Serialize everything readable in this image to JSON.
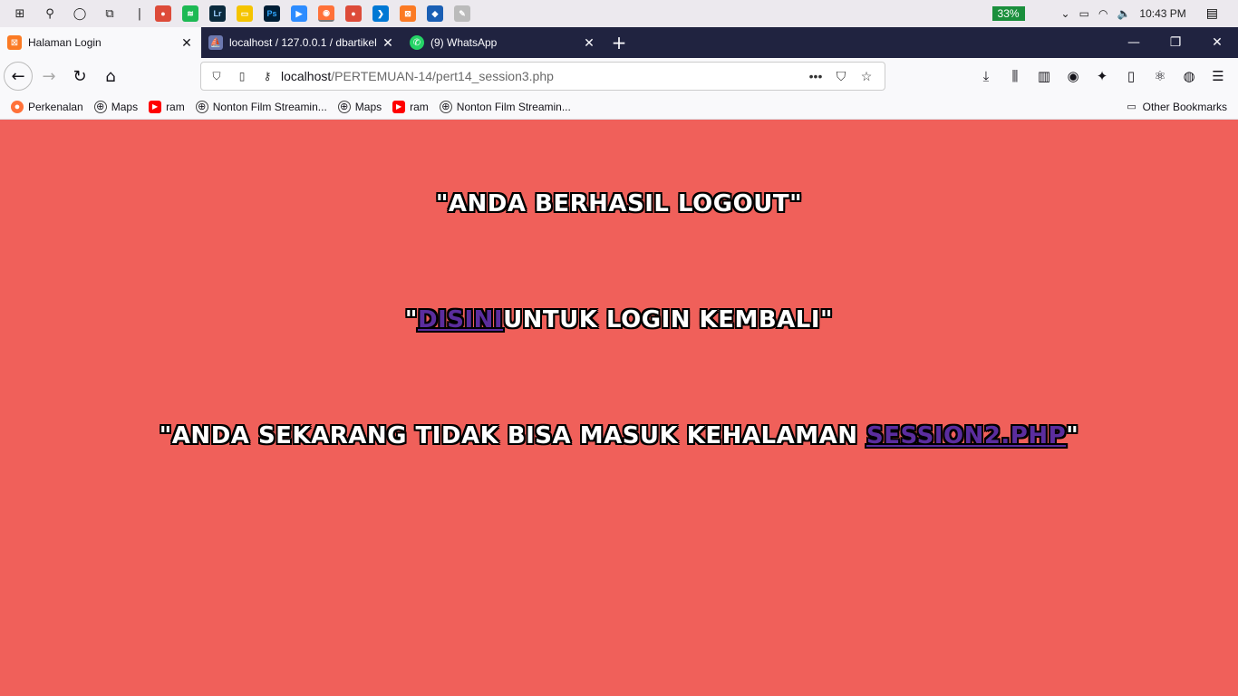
{
  "taskbar": {
    "battery": "33%",
    "time": "10:43 PM"
  },
  "tabs": [
    {
      "title": "Halaman Login",
      "active": true
    },
    {
      "title": "localhost / 127.0.0.1 / dbartikel",
      "active": false
    },
    {
      "title": "(9) WhatsApp",
      "active": false
    }
  ],
  "url": {
    "host": "localhost",
    "path": "/PERTEMUAN-14/pert14_session3.php"
  },
  "bookmarks": [
    {
      "label": "Perkenalan",
      "icon": "firefox-icon"
    },
    {
      "label": "Maps",
      "icon": "globe-icon"
    },
    {
      "label": "ram",
      "icon": "youtube-icon"
    },
    {
      "label": "Nonton Film Streamin...",
      "icon": "globe-icon"
    },
    {
      "label": "Maps",
      "icon": "globe-icon"
    },
    {
      "label": "ram",
      "icon": "youtube-icon"
    },
    {
      "label": "Nonton Film Streamin...",
      "icon": "globe-icon"
    }
  ],
  "other_bookmarks": "Other Bookmarks",
  "content": {
    "line1": "\"ANDA BERHASIL LOGOUT\"",
    "line2_prefix": "\"",
    "line2_link": "DISINI",
    "line2_suffix": "UNTUK LOGIN KEMBALI\"",
    "line3_prefix": "\"ANDA SEKARANG TIDAK BISA MASUK KEHALAMAN ",
    "line3_link": "SESSION2.PHP",
    "line3_suffix": "\""
  },
  "colors": {
    "background": "#f0605a",
    "link": "#5b2d9e",
    "tabstrip": "#202340"
  }
}
